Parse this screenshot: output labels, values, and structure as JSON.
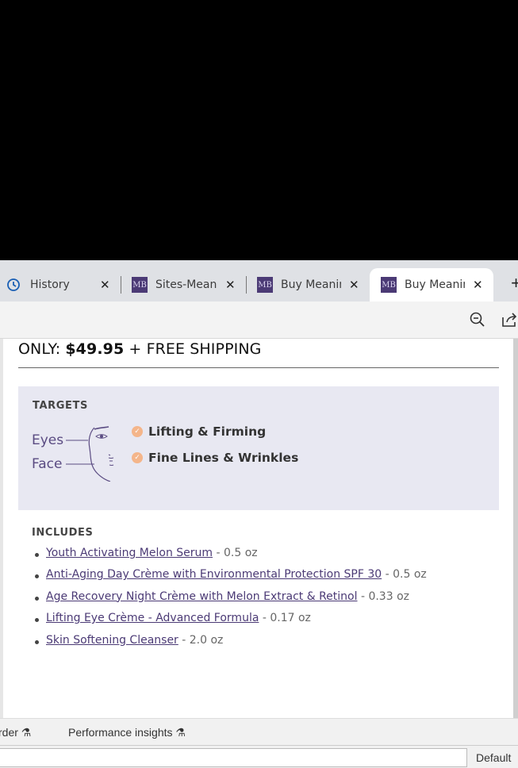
{
  "tabs": [
    {
      "label": "History",
      "icon": "history-icon"
    },
    {
      "label": "Sites-Meaningful",
      "icon": "mb-favicon"
    },
    {
      "label": "Buy Meaningful",
      "icon": "mb-favicon"
    },
    {
      "label": "Buy Meaningful",
      "icon": "mb-favicon",
      "active": true
    }
  ],
  "favicon_text": "MB",
  "close_glyph": "✕",
  "new_tab_glyph": "+",
  "toolbar": {
    "zoom_icon": "zoom-out-icon",
    "share_icon": "share-icon"
  },
  "price": {
    "prefix": "ONLY: ",
    "amount": "$49.95",
    "suffix": " + FREE SHIPPING"
  },
  "targets": {
    "title": "TARGETS",
    "eyes_label": "Eyes",
    "face_label": "Face",
    "items": [
      "Lifting & Firming",
      "Fine Lines & Wrinkles"
    ],
    "check_color": "#f4b58a"
  },
  "includes": {
    "title": "INCLUDES",
    "items": [
      {
        "name": "Youth Activating Melon Serum",
        "size": " - 0.5 oz"
      },
      {
        "name": "Anti-Aging Day Crème with Environmental Protection SPF 30",
        "size": " - 0.5 oz"
      },
      {
        "name": "Age Recovery Night Crème with Melon Extract & Retinol",
        "size": " - 0.33 oz"
      },
      {
        "name": "Lifting Eye Crème - Advanced Formula",
        "size": " - 0.17 oz"
      },
      {
        "name": "Skin Softening Cleanser",
        "size": " - 2.0 oz"
      }
    ]
  },
  "devtools": {
    "tab1": "rder",
    "tab2": "Performance insights",
    "level": "Default"
  },
  "colors": {
    "brand": "#4b3a75",
    "panel": "#e8e8f2"
  }
}
